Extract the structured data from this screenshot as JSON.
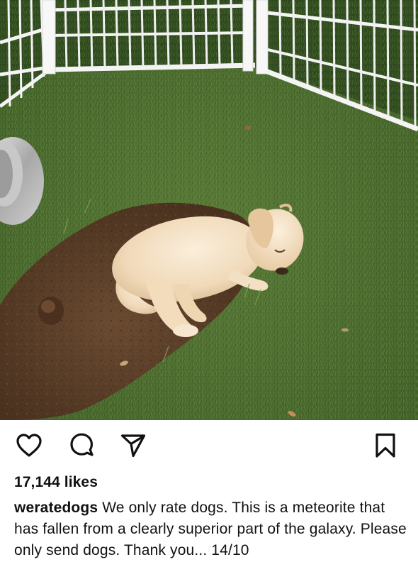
{
  "post": {
    "image_alt": "Golden retriever puppy asleep in a dug-out patch of dirt inside a white fenced grass pen",
    "likes_text": "17,144 likes",
    "username": "weratedogs",
    "caption_text": "We only rate dogs. This is a meteorite that has fallen from a clearly superior part of the galaxy. Please only send dogs. Thank you... 14/10"
  },
  "actions": {
    "like_icon": "heart-icon",
    "comment_icon": "comment-icon",
    "share_icon": "send-icon",
    "save_icon": "bookmark-icon"
  },
  "colors": {
    "icon": "#111111",
    "text": "#111111",
    "grass": "#4a6b2e",
    "dirt": "#5a3f29",
    "puppy": "#f0dcc0"
  }
}
